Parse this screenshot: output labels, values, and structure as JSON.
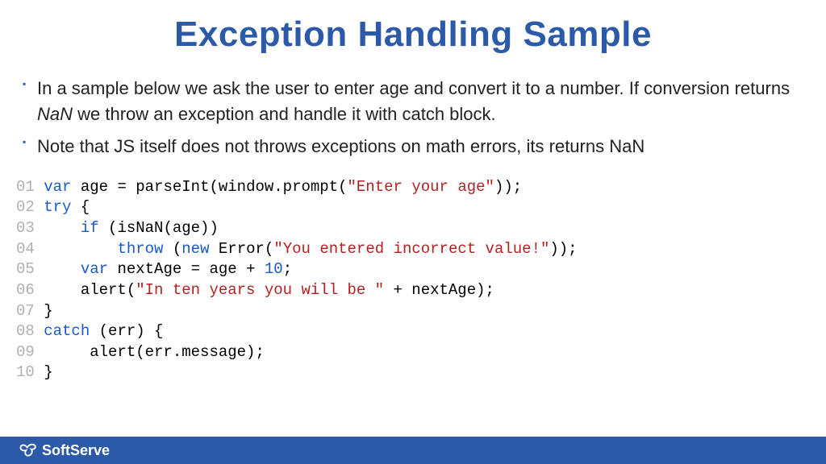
{
  "title": "Exception Handling Sample",
  "bullets": [
    {
      "html": "In a sample below we ask the user to enter age and convert it to a number. If conversion returns <em>NaN</em> we throw an exception and handle it with catch block."
    },
    {
      "html": "Note that JS itself does not throws exceptions on math errors, its returns NaN"
    }
  ],
  "code_lines": [
    {
      "n": "01",
      "tokens": [
        {
          "t": " ",
          "c": ""
        },
        {
          "t": "var",
          "c": "kw"
        },
        {
          "t": " age = parseInt(window.prompt(",
          "c": ""
        },
        {
          "t": "\"Enter your age\"",
          "c": "str"
        },
        {
          "t": "));",
          "c": ""
        }
      ]
    },
    {
      "n": "02",
      "tokens": [
        {
          "t": " ",
          "c": ""
        },
        {
          "t": "try",
          "c": "kw"
        },
        {
          "t": " {",
          "c": ""
        }
      ]
    },
    {
      "n": "03",
      "tokens": [
        {
          "t": "     ",
          "c": ""
        },
        {
          "t": "if",
          "c": "kw"
        },
        {
          "t": " (isNaN(age))",
          "c": ""
        }
      ]
    },
    {
      "n": "04",
      "tokens": [
        {
          "t": "         ",
          "c": ""
        },
        {
          "t": "throw",
          "c": "kw"
        },
        {
          "t": " (",
          "c": ""
        },
        {
          "t": "new",
          "c": "kw"
        },
        {
          "t": " Error(",
          "c": ""
        },
        {
          "t": "\"You entered incorrect value!\"",
          "c": "str"
        },
        {
          "t": "));",
          "c": ""
        }
      ]
    },
    {
      "n": "05",
      "tokens": [
        {
          "t": "     ",
          "c": ""
        },
        {
          "t": "var",
          "c": "kw"
        },
        {
          "t": " nextAge = age + ",
          "c": ""
        },
        {
          "t": "10",
          "c": "num"
        },
        {
          "t": ";",
          "c": ""
        }
      ]
    },
    {
      "n": "06",
      "tokens": [
        {
          "t": "     alert(",
          "c": ""
        },
        {
          "t": "\"In ten years you will be \"",
          "c": "str"
        },
        {
          "t": " + nextAge);",
          "c": ""
        }
      ]
    },
    {
      "n": "07",
      "tokens": [
        {
          "t": " }",
          "c": ""
        }
      ]
    },
    {
      "n": "08",
      "tokens": [
        {
          "t": " ",
          "c": ""
        },
        {
          "t": "catch",
          "c": "kw"
        },
        {
          "t": " (err) {",
          "c": ""
        }
      ]
    },
    {
      "n": "09",
      "tokens": [
        {
          "t": "      alert(err.message);",
          "c": ""
        }
      ]
    },
    {
      "n": "10",
      "tokens": [
        {
          "t": " }",
          "c": ""
        }
      ]
    }
  ],
  "footer": {
    "brand": "SoftServe"
  }
}
